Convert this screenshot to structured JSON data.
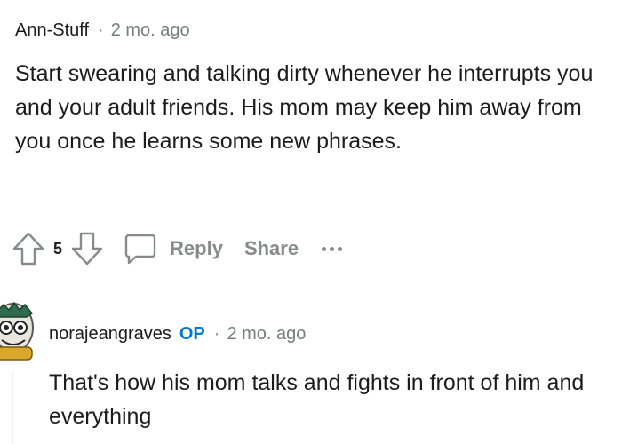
{
  "comment1": {
    "author": "Ann-Stuff",
    "separator": "·",
    "time": "2 mo. ago",
    "body": "Start swearing and talking dirty whenever he interrupts you and your adult friends. His mom may keep him away from you once he learns some new phrases.",
    "votes": "5",
    "reply_label": "Reply",
    "share_label": "Share"
  },
  "comment2": {
    "author": "norajeangraves",
    "op_badge": "OP",
    "separator": "·",
    "time": "2 mo. ago",
    "body": "That's how his mom talks and fights in front of him and everything"
  },
  "icons": [
    "upvote-icon",
    "downvote-icon",
    "comment-icon",
    "more-icon",
    "avatar"
  ],
  "colors": {
    "op": "#0079d3",
    "muted": "#878a8c",
    "text": "#1c1c1c"
  }
}
